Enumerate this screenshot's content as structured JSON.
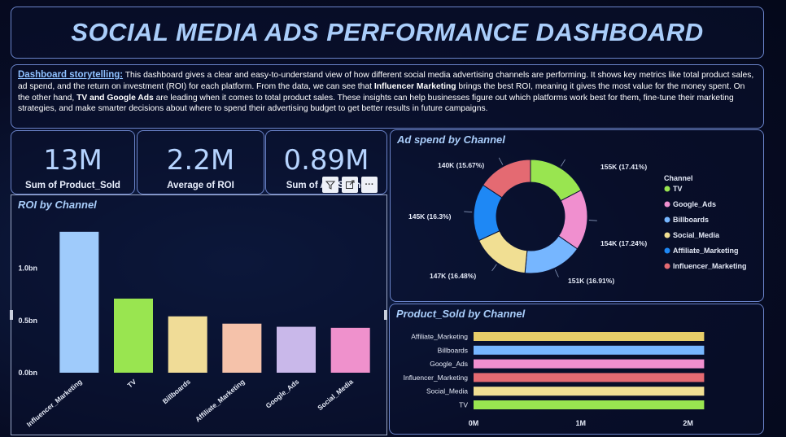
{
  "title": "SOCIAL MEDIA ADS PERFORMANCE DASHBOARD",
  "storytelling": {
    "label": "Dashboard storytelling:",
    "part1": " This dashboard gives a clear and easy-to-understand view of how different social media advertising channels are performing. It shows key metrics like total product sales, ad spend, and the return on investment (ROI) for each platform. From the data, we can see that ",
    "bold1": "Influencer Marketing",
    "part2": " brings the best ROI, meaning it gives the most value for the money spent. On the other hand, ",
    "bold2": "TV and Google Ads",
    "part3": " are leading when it comes to total product sales. These insights can help businesses figure out which platforms work best for them, fine-tune their marketing strategies, and make smarter decisions about where to spend their advertising budget to get better results in future campaigns."
  },
  "kpis": [
    {
      "value": "13M",
      "label": "Sum of Product_Sold"
    },
    {
      "value": "2.2M",
      "label": "Average of ROI"
    },
    {
      "value": "0.89M",
      "label": "Sum of Ad_Spend"
    }
  ],
  "toolbar": {
    "filter_icon": "filter-icon",
    "focus_icon": "focus-mode-icon",
    "more_label": "···"
  },
  "colors": {
    "TV": "#99e550",
    "Google_Ads": "#f08fcf",
    "Billboards": "#76b6ff",
    "Social_Media": "#f1df93",
    "Affiliate_Marketing": "#1e88f5",
    "Influencer_Marketing": "#e46a72"
  },
  "chart_data": [
    {
      "type": "bar",
      "title": "ROI by Channel",
      "categories": [
        "Influencer_Marketing",
        "TV",
        "Billboards",
        "Affiliate_Marketing",
        "Google_Ads",
        "Social_Media"
      ],
      "values": [
        1.35,
        0.71,
        0.54,
        0.47,
        0.44,
        0.43
      ],
      "bar_colors": [
        "#9fcbfb",
        "#99e550",
        "#f0dc97",
        "#f5c2aa",
        "#c9b8ea",
        "#ef91cc"
      ],
      "yticks": [
        {
          "v": 0,
          "label": "0.0bn"
        },
        {
          "v": 0.5,
          "label": "0.5bn"
        },
        {
          "v": 1.0,
          "label": "1.0bn"
        }
      ],
      "ylim": [
        0,
        1.45
      ]
    },
    {
      "type": "pie",
      "title": "Ad spend by Channel",
      "legend_title": "Channel",
      "categories": [
        "TV",
        "Google_Ads",
        "Billboards",
        "Social_Media",
        "Affiliate_Marketing",
        "Influencer_Marketing"
      ],
      "values": [
        155,
        154,
        151,
        147,
        145,
        140
      ],
      "labels": [
        "155K (17.41%)",
        "154K (17.24%)",
        "151K (16.91%)",
        "147K (16.48%)",
        "145K (16.3%)",
        "140K (15.67%)"
      ],
      "colors": [
        "#99e550",
        "#f08fcf",
        "#76b6ff",
        "#f1df93",
        "#1e88f5",
        "#e46a72"
      ],
      "legend_placement": "right"
    },
    {
      "type": "bar",
      "orientation": "horizontal",
      "title": "Product_Sold by Channel",
      "categories": [
        "Affiliate_Marketing",
        "Billboards",
        "Google_Ads",
        "Influencer_Marketing",
        "Social_Media",
        "TV"
      ],
      "values": [
        2.15,
        2.15,
        2.15,
        2.15,
        2.15,
        2.15
      ],
      "bar_colors": [
        "#e7cd69",
        "#76b6ff",
        "#f08fcf",
        "#e46a72",
        "#f1df93",
        "#99e550"
      ],
      "xticks": [
        {
          "v": 0,
          "label": "0M"
        },
        {
          "v": 1,
          "label": "1M"
        },
        {
          "v": 2,
          "label": "2M"
        }
      ],
      "xlim": [
        0,
        2.2
      ]
    }
  ]
}
